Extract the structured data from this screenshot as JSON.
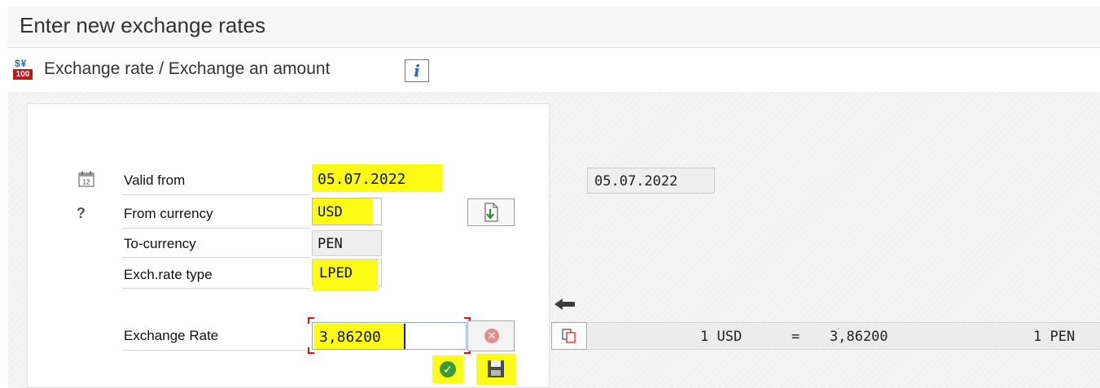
{
  "window": {
    "title": "Enter new exchange rates"
  },
  "toolbar": {
    "icon_top": "$¥",
    "icon_bottom": "100",
    "label": "Exchange rate / Exchange an amount",
    "info_label": "i"
  },
  "form": {
    "valid_from": {
      "label": "Valid from",
      "value": "05.07.2022"
    },
    "from_currency": {
      "label": "From currency",
      "value": "USD"
    },
    "to_currency": {
      "label": "To-currency",
      "value": "PEN"
    },
    "rate_type": {
      "label": "Exch.rate type",
      "value": "LPED"
    },
    "exchange_rate": {
      "label": "Exchange Rate",
      "value": "3,86200"
    }
  },
  "result": {
    "date": "05.07.2022",
    "from_amount": "1 USD",
    "equals": "=",
    "rate": "3,86200",
    "to_amount": "1 PEN"
  },
  "colors": {
    "highlight": "#fbfb16",
    "ok_green": "#3a9a33",
    "cancel_red": "#e08f8f",
    "info_blue": "#1a6fb8"
  },
  "icons": [
    "calendar-icon",
    "help-icon",
    "money-exchange-icon",
    "info-icon",
    "swap-currency-icon",
    "cancel-icon",
    "ok-check-icon",
    "save-icon",
    "arrow-left-icon",
    "copy-icon"
  ]
}
